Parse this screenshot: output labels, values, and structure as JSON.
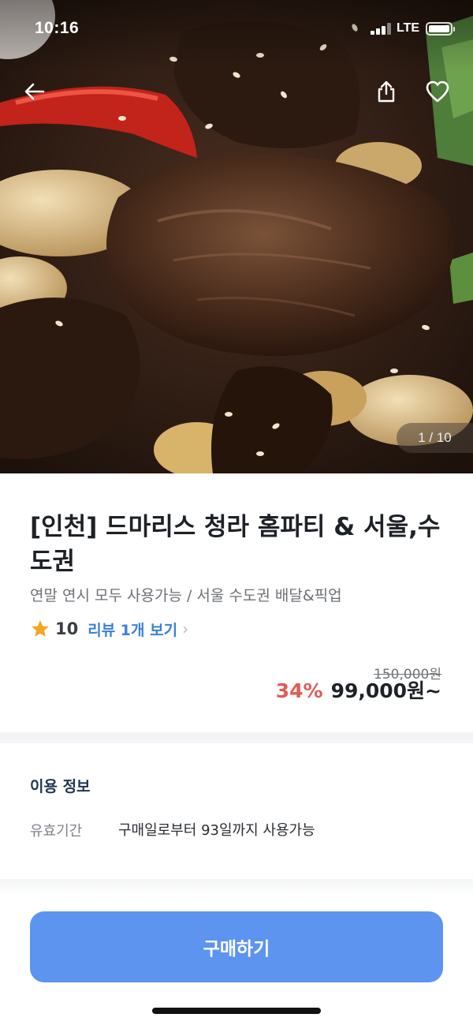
{
  "status_bar": {
    "time": "10:16",
    "network": "LTE"
  },
  "hero": {
    "image_counter": "1 / 10",
    "icons": {
      "back": "arrow-left-icon",
      "share": "share-icon",
      "favorite": "heart-outline-icon"
    }
  },
  "product": {
    "title": "[인천] 드마리스 청라 홈파티 & 서울,수도권",
    "subtitle": "연말 연시 모두 사용가능 / 서울 수도권 배달&픽업",
    "rating": "10",
    "review_link": "리뷰 1개 보기",
    "original_price": "150,000원",
    "discount": "34%",
    "price": "99,000원~"
  },
  "usage_info": {
    "heading": "이용 정보",
    "rows": [
      {
        "label": "유효기간",
        "value": "구매일로부터 93일까지 사용가능"
      }
    ]
  },
  "footer": {
    "buy_label": "구매하기"
  },
  "colors": {
    "accent": "#5c94f0",
    "discount": "#e05c57",
    "link": "#3d7fd8",
    "star": "#f5a623"
  }
}
